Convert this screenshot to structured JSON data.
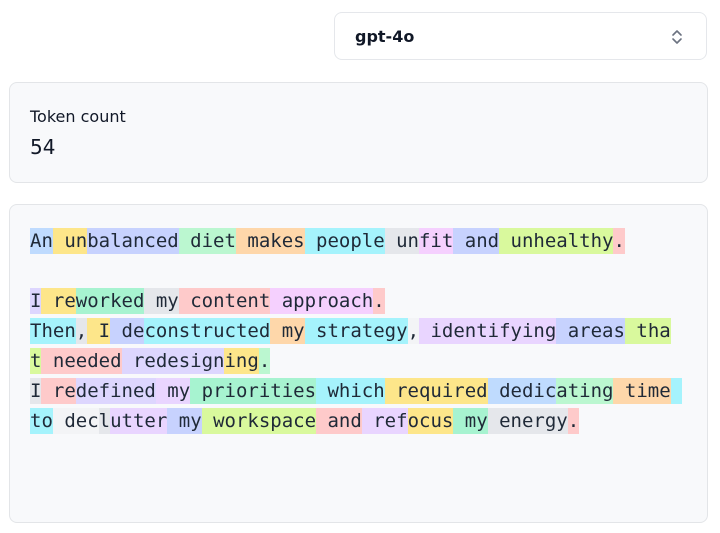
{
  "model_select": {
    "value": "gpt-4o",
    "icon": "chevron-up-down-icon"
  },
  "token_count": {
    "label": "Token count",
    "value": "54"
  },
  "tokens": [
    {
      "t": "An",
      "c": "#bfdbfe"
    },
    {
      "t": " un",
      "c": "#fde68a"
    },
    {
      "t": "balanced",
      "c": "#c7d2fe"
    },
    {
      "t": " diet",
      "c": "#bbf7d0"
    },
    {
      "t": " makes",
      "c": "#fed7aa"
    },
    {
      "t": " people",
      "c": "#a5f3fc"
    },
    {
      "t": " un",
      "c": "#e5e7eb"
    },
    {
      "t": "fit",
      "c": "#f5d0fe"
    },
    {
      "t": " and",
      "c": "#c7d2fe"
    },
    {
      "t": " unhealthy",
      "c": "#d9f99d"
    },
    {
      "t": ".",
      "c": "#fecaca"
    },
    {
      "t": "\n\n",
      "c": "transparent"
    },
    {
      "t": "I",
      "c": "#ddd6fe"
    },
    {
      "t": " re",
      "c": "#fde68a"
    },
    {
      "t": "worked",
      "c": "#a7f3d0"
    },
    {
      "t": " my",
      "c": "#e5e7eb"
    },
    {
      "t": " content",
      "c": "#fecaca"
    },
    {
      "t": " approach",
      "c": "#f5d0fe"
    },
    {
      "t": ".\n",
      "c": "#fecaca"
    },
    {
      "t": "Then",
      "c": "#a5f3fc"
    },
    {
      "t": ",",
      "c": "#e5e7eb"
    },
    {
      "t": " I",
      "c": "#fde68a"
    },
    {
      "t": " de",
      "c": "#c7d2fe"
    },
    {
      "t": "constructed",
      "c": "#a5f3fc"
    },
    {
      "t": " my",
      "c": "#fed7aa"
    },
    {
      "t": " strategy",
      "c": "#a5f3fc"
    },
    {
      "t": ",",
      "c": "#f3f4f6"
    },
    {
      "t": " identifying",
      "c": "#e9d5ff"
    },
    {
      "t": " areas",
      "c": "#c7d2fe"
    },
    {
      "t": " that",
      "c": "#d9f99d"
    },
    {
      "t": " needed",
      "c": "#fecaca"
    },
    {
      "t": " redesign",
      "c": "#ddd6fe"
    },
    {
      "t": "ing",
      "c": "#fde68a"
    },
    {
      "t": ".\n",
      "c": "#bbf7d0"
    },
    {
      "t": "I",
      "c": "#e5e7eb"
    },
    {
      "t": " re",
      "c": "#fecaca"
    },
    {
      "t": "defined",
      "c": "#ddd6fe"
    },
    {
      "t": " my",
      "c": "#e9d5ff"
    },
    {
      "t": " priorities",
      "c": "#a7f3d0"
    },
    {
      "t": " which",
      "c": "#a5f3fc"
    },
    {
      "t": " required",
      "c": "#fde68a"
    },
    {
      "t": " dedic",
      "c": "#bfdbfe"
    },
    {
      "t": "ating",
      "c": "#bbf7d0"
    },
    {
      "t": " time",
      "c": "#fed7aa"
    },
    {
      "t": " to",
      "c": "#a5f3fc"
    },
    {
      "t": " dec",
      "c": "#f3f4f6"
    },
    {
      "t": "l",
      "c": "#e5e7eb"
    },
    {
      "t": "utter",
      "c": "#e9d5ff"
    },
    {
      "t": " my",
      "c": "#c7d2fe"
    },
    {
      "t": " workspace",
      "c": "#d9f99d"
    },
    {
      "t": " and",
      "c": "#fecaca"
    },
    {
      "t": " ref",
      "c": "#e9d5ff"
    },
    {
      "t": "ocus",
      "c": "#fde68a"
    },
    {
      "t": " my",
      "c": "#a7f3d0"
    },
    {
      "t": " energy",
      "c": "#e5e7eb"
    },
    {
      "t": ".",
      "c": "#fecaca"
    }
  ]
}
